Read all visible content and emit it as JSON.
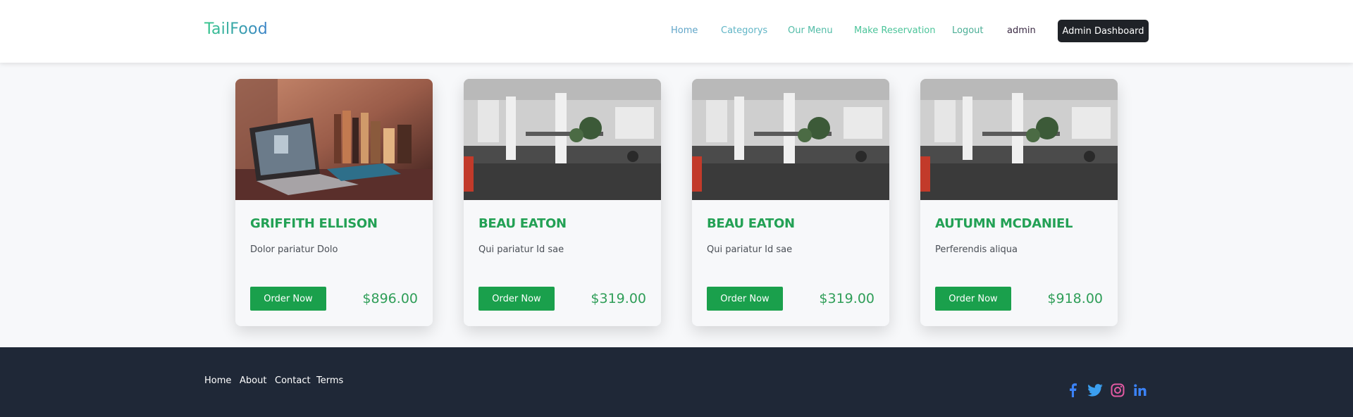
{
  "header": {
    "brand": "TailFood",
    "nav": {
      "home": "Home",
      "categorys": "Categorys",
      "our_menu": "Our Menu",
      "make_reservation": "Make Reservation",
      "logout": "Logout",
      "user": "admin"
    },
    "admin_button": "Admin Dashboard"
  },
  "cards": [
    {
      "title": "GRIFFITH ELLISON",
      "description": "Dolor pariatur Dolo",
      "button": "Order Now",
      "price": "$896.00",
      "image": "laptop-desk-photo"
    },
    {
      "title": "BEAU EATON",
      "description": "Qui pariatur Id sae",
      "button": "Order Now",
      "price": "$319.00",
      "image": "office-interior-photo"
    },
    {
      "title": "BEAU EATON",
      "description": "Qui pariatur Id sae",
      "button": "Order Now",
      "price": "$319.00",
      "image": "office-interior-photo"
    },
    {
      "title": "AUTUMN MCDANIEL",
      "description": "Perferendis aliqua",
      "button": "Order Now",
      "price": "$918.00",
      "image": "office-interior-photo"
    }
  ],
  "footer": {
    "links": [
      "Home",
      "About",
      "Contact",
      "Terms"
    ],
    "social_icons": [
      "facebook-icon",
      "twitter-icon",
      "instagram-icon",
      "linkedin-icon"
    ]
  },
  "colors": {
    "accent_green": "#1aa04c",
    "title_green": "#23a155",
    "footer_bg": "#1f2837",
    "admin_button_bg": "#1f2227"
  }
}
